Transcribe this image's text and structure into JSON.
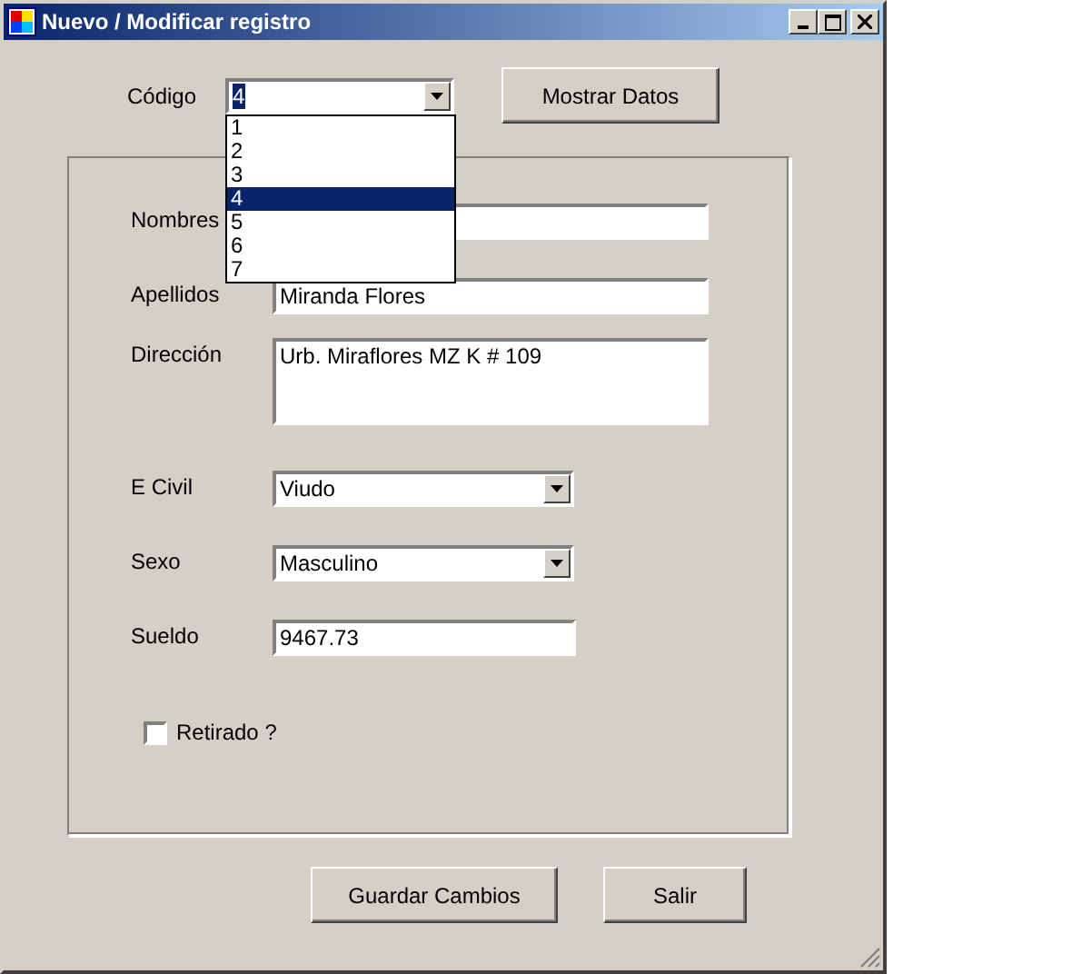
{
  "window": {
    "title": "Nuevo / Modificar registro"
  },
  "codigo": {
    "label": "Código",
    "value": "4",
    "expanded": true,
    "options": [
      {
        "label": "1",
        "selected": false
      },
      {
        "label": "2",
        "selected": false
      },
      {
        "label": "3",
        "selected": false
      },
      {
        "label": "4",
        "selected": true
      },
      {
        "label": "5",
        "selected": false
      },
      {
        "label": "6",
        "selected": false
      },
      {
        "label": "7",
        "selected": false
      }
    ]
  },
  "show_button": "Mostrar Datos",
  "fields": [
    {
      "kind": "text",
      "label": "Nombres"
    },
    {
      "kind": "text",
      "label": "Apellidos",
      "value": "Miranda Flores"
    },
    {
      "kind": "textarea",
      "label": "Dirección",
      "value": "Urb. Miraflores MZ K # 109"
    },
    {
      "kind": "combo",
      "label": "E Civil",
      "value": "Viudo"
    },
    {
      "kind": "combo",
      "label": "Sexo",
      "value": "Masculino"
    },
    {
      "kind": "short",
      "label": "Sueldo",
      "value": "9467.73"
    }
  ],
  "retirado": {
    "label": "Retirado ?",
    "checked": false
  },
  "buttons": [
    "Guardar Cambios",
    "Salir"
  ]
}
